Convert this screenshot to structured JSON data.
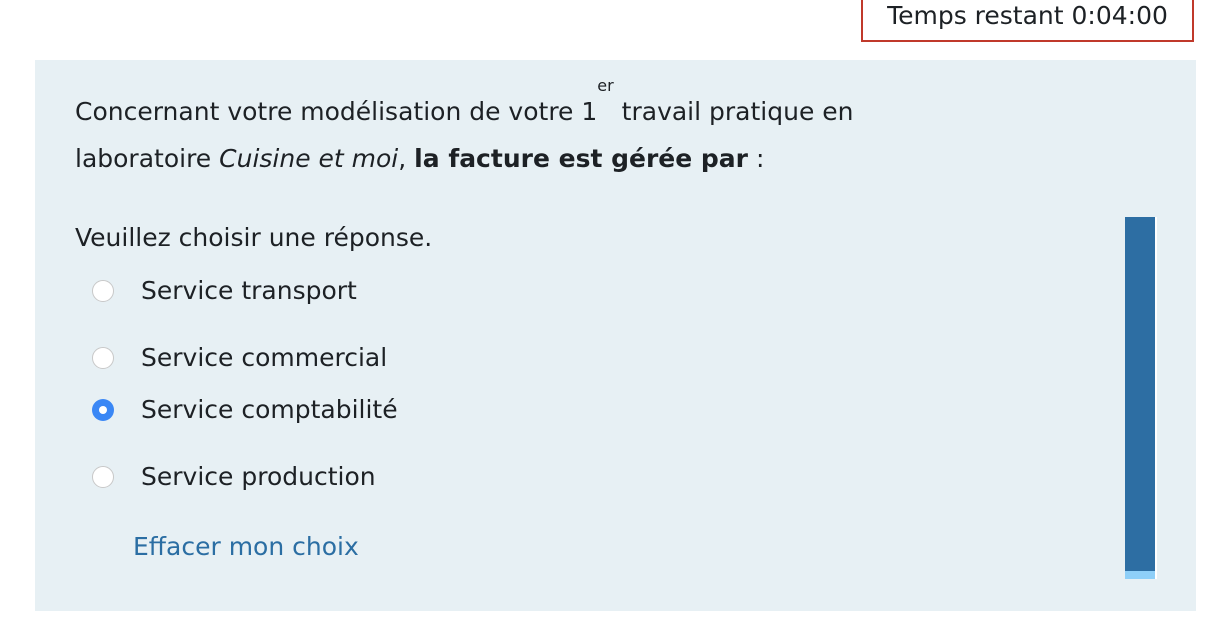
{
  "timer": {
    "label": "Temps restant 0:04:00"
  },
  "question": {
    "part1": "Concernant votre modélisation de votre 1",
    "sup": "er",
    "part2": " travail pratique en laboratoire ",
    "italic": "Cuisine et moi",
    "part3": ", ",
    "bold": "la facture est gérée par",
    "part4": " :"
  },
  "prompt": "Veuillez choisir une réponse.",
  "options": [
    {
      "label": "Service transport",
      "checked": false
    },
    {
      "label": "Service commercial",
      "checked": false
    },
    {
      "label": "Service comptabilité",
      "checked": true
    },
    {
      "label": "Service production",
      "checked": false
    }
  ],
  "clear_label": "Effacer mon choix",
  "progress": {
    "fraction_light": 0.022,
    "color": "#2d6ea3",
    "light_color": "#8ecff8"
  }
}
